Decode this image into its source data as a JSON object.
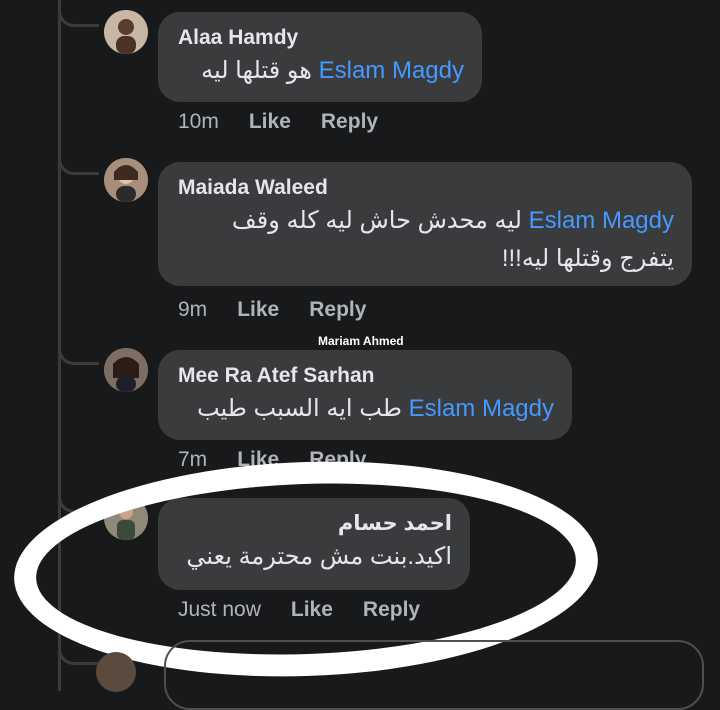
{
  "comments": [
    {
      "author": "Alaa Hamdy",
      "mention": "Eslam Magdy",
      "text": "هو قتلها ليه",
      "time": "10m",
      "like": "Like",
      "reply": "Reply"
    },
    {
      "author": "Maiada Waleed",
      "mention": "Eslam Magdy",
      "text": "ليه محدش حاش ليه كله وقف",
      "text2": "يتفرج وقتلها ليه!!!",
      "time": "9m",
      "like": "Like",
      "reply": "Reply"
    },
    {
      "author": "Mee Ra Atef Sarhan",
      "mention": "Eslam Magdy",
      "text": "طب ايه السبب طيب",
      "time": "7m",
      "like": "Like",
      "reply": "Reply"
    },
    {
      "author": "احمد حسام",
      "text": "اكيد.بنت مش محترمة يعني",
      "time": "Just now",
      "like": "Like",
      "reply": "Reply"
    }
  ],
  "watermark": "Mariam Ahmed",
  "colors": {
    "background": "#18191a",
    "bubble": "#3a3b3c",
    "mention": "#4599ff",
    "meta": "#b0b3b8",
    "highlight": "#ffffff"
  }
}
